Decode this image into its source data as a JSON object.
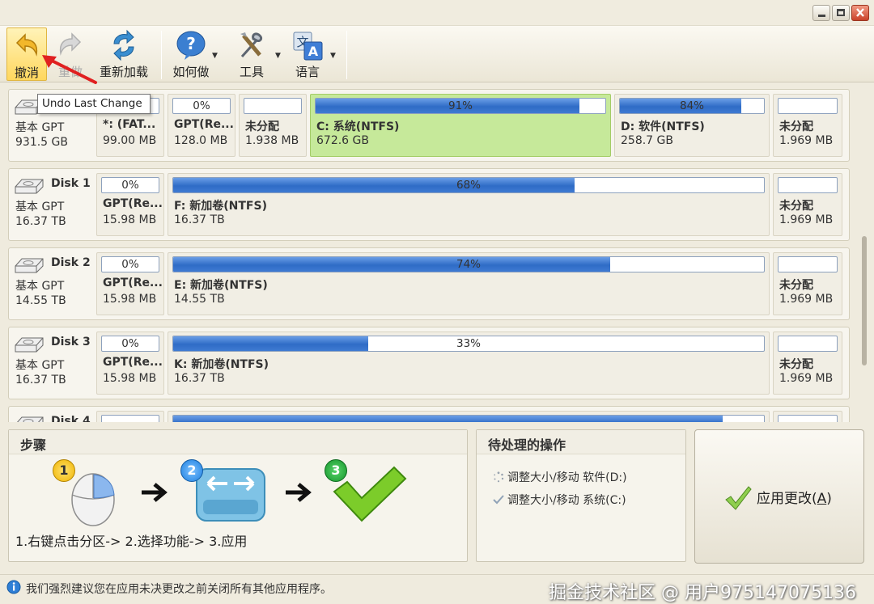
{
  "toolbar": {
    "undo_label": "撤消",
    "redo_label": "重做",
    "reload_label": "重新加载",
    "howto_label": "如何做",
    "tools_label": "工具",
    "language_label": "语言"
  },
  "tooltip": "Undo Last Change",
  "disks": [
    {
      "name": "",
      "type": "基本 GPT",
      "size": "931.5 GB",
      "partitions": [
        {
          "name": "*: (FAT...",
          "size": "99.00 MB",
          "usage": 0.42,
          "pct_label": ""
        },
        {
          "name": "GPT(Re...",
          "size": "128.0 MB",
          "usage": 0,
          "pct_label": "0%"
        },
        {
          "name": "未分配",
          "size": "1.938 MB",
          "usage": 0,
          "pct_label": ""
        },
        {
          "name": "C: 系统(NTFS)",
          "size": "672.6 GB",
          "usage": 0.91,
          "pct_label": "91%",
          "selected": true
        },
        {
          "name": "D: 软件(NTFS)",
          "size": "258.7 GB",
          "usage": 0.84,
          "pct_label": "84%"
        },
        {
          "name": "未分配",
          "size": "1.969 MB",
          "usage": 0,
          "pct_label": ""
        }
      ]
    },
    {
      "name": "Disk 1",
      "type": "基本 GPT",
      "size": "16.37 TB",
      "partitions": [
        {
          "name": "GPT(Re...",
          "size": "15.98 MB",
          "usage": 0,
          "pct_label": "0%"
        },
        {
          "name": "F: 新加卷(NTFS)",
          "size": "16.37 TB",
          "usage": 0.68,
          "pct_label": "68%"
        },
        {
          "name": "未分配",
          "size": "1.969 MB",
          "usage": 0,
          "pct_label": ""
        }
      ]
    },
    {
      "name": "Disk 2",
      "type": "基本 GPT",
      "size": "14.55 TB",
      "partitions": [
        {
          "name": "GPT(Re...",
          "size": "15.98 MB",
          "usage": 0,
          "pct_label": "0%"
        },
        {
          "name": "E: 新加卷(NTFS)",
          "size": "14.55 TB",
          "usage": 0.74,
          "pct_label": "74%"
        },
        {
          "name": "未分配",
          "size": "1.969 MB",
          "usage": 0,
          "pct_label": ""
        }
      ]
    },
    {
      "name": "Disk 3",
      "type": "基本 GPT",
      "size": "16.37 TB",
      "partitions": [
        {
          "name": "GPT(Re...",
          "size": "15.98 MB",
          "usage": 0,
          "pct_label": "0%"
        },
        {
          "name": "K: 新加卷(NTFS)",
          "size": "16.37 TB",
          "usage": 0.33,
          "pct_label": "33%"
        },
        {
          "name": "未分配",
          "size": "1.969 MB",
          "usage": 0,
          "pct_label": ""
        }
      ]
    },
    {
      "name": "Disk 4",
      "type": "",
      "size": "",
      "partitions": [
        {
          "name": "",
          "size": "",
          "usage": 0,
          "pct_label": ""
        },
        {
          "name": "",
          "size": "",
          "usage": 0.93,
          "pct_label": ""
        },
        {
          "name": "",
          "size": "",
          "usage": 0,
          "pct_label": ""
        }
      ]
    }
  ],
  "steps": {
    "title": "步骤",
    "badges": [
      "1",
      "2",
      "3"
    ],
    "text": "1.右键点击分区-> 2.选择功能-> 3.应用"
  },
  "pending": {
    "title": "待处理的操作",
    "items": [
      "调整大小/移动 软件(D:)",
      "调整大小/移动 系统(C:)"
    ]
  },
  "apply_button": {
    "label": "应用更改(",
    "accel": "A",
    "suffix": ")"
  },
  "status": {
    "text": "我们强烈建议您在应用未决更改之前关闭所有其他应用程序。"
  },
  "watermark": "掘金技术社区 @ 用户975147075136",
  "colors": {
    "selected": "#c6e99a",
    "bar": "#2f6cc6",
    "arrow": "#e02020"
  }
}
